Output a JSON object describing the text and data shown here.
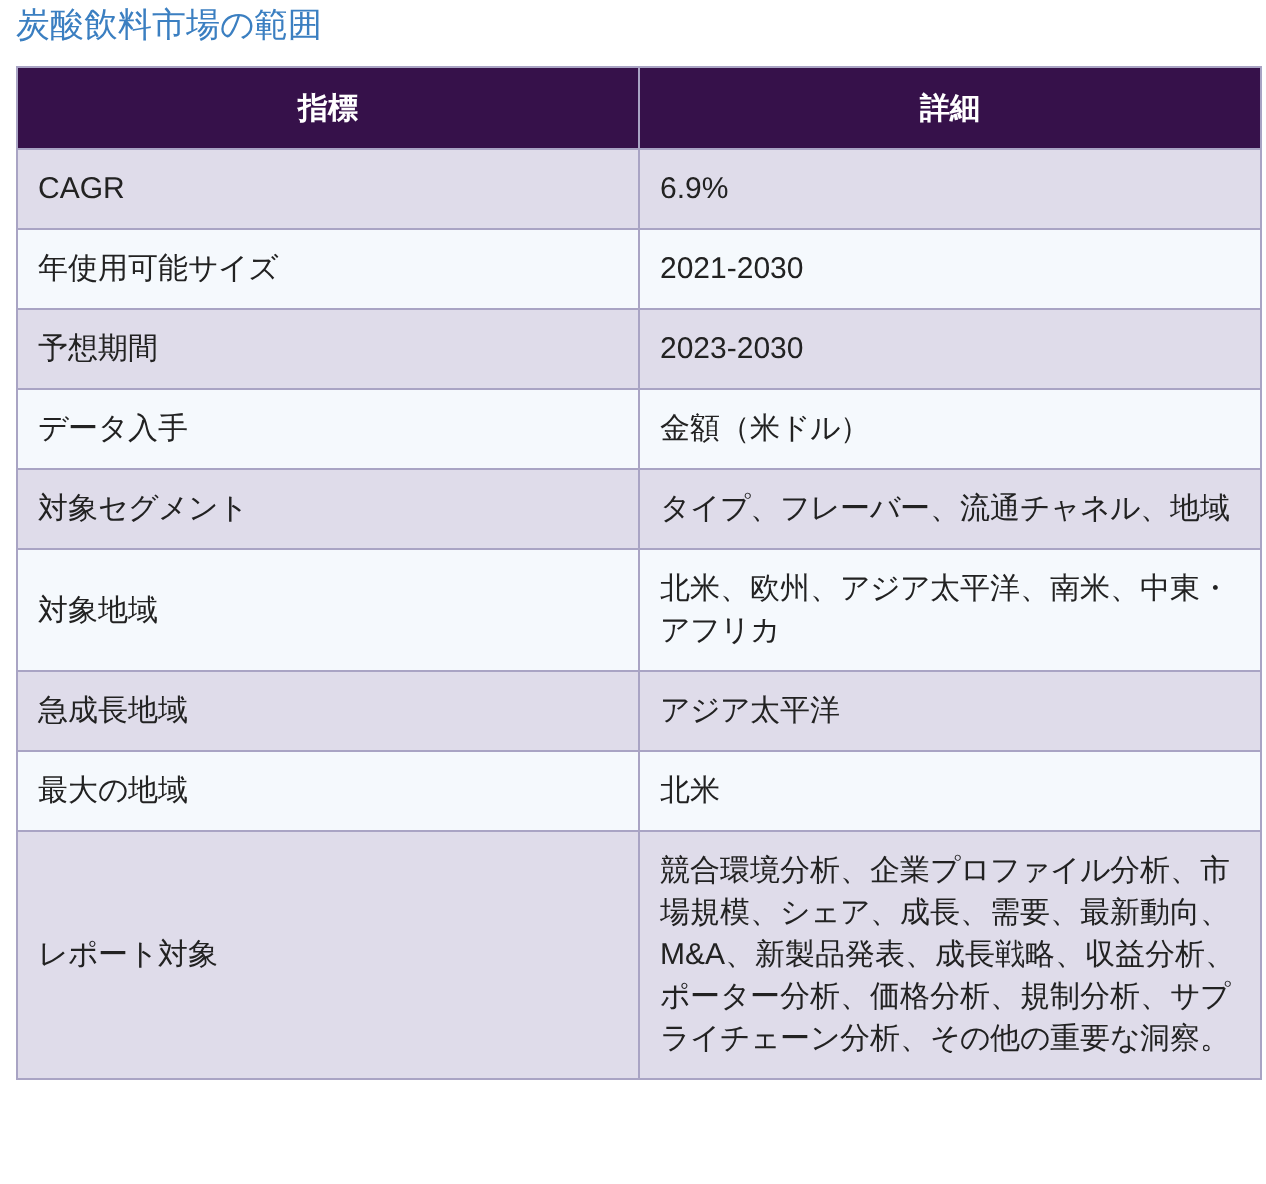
{
  "title": "炭酸飲料市場の範囲",
  "table": {
    "columns": [
      "指標",
      "詳細"
    ],
    "rows": [
      {
        "label": "CAGR",
        "value": "6.9%"
      },
      {
        "label": "年使用可能サイズ",
        "value": "2021-2030"
      },
      {
        "label": "予想期間",
        "value": "2023-2030"
      },
      {
        "label": "データ入手",
        "value": "金額（米ドル）"
      },
      {
        "label": "対象セグメント",
        "value": "タイプ、フレーバー、流通チャネル、地域"
      },
      {
        "label": "対象地域",
        "value": "北米、欧州、アジア太平洋、南米、中東・アフリカ"
      },
      {
        "label": "急成長地域",
        "value": "アジア太平洋"
      },
      {
        "label": "最大の地域",
        "value": "北米"
      },
      {
        "label": "レポート対象",
        "value": "競合環境分析、企業プロファイル分析、市場規模、シェア、成長、需要、最新動向、M&A、新製品発表、成長戦略、収益分析、ポーター分析、価格分析、規制分析、サプライチェーン分析、その他の重要な洞察。"
      }
    ]
  }
}
